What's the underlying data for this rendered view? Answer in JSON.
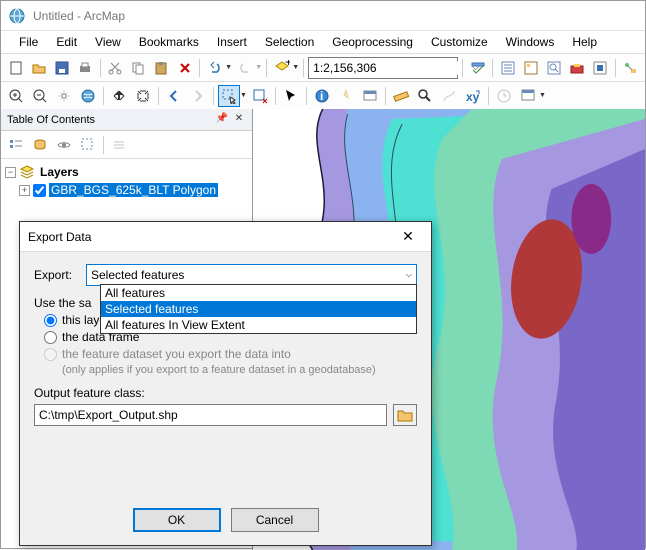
{
  "titlebar": {
    "text": "Untitled - ArcMap"
  },
  "menu": {
    "items": [
      "File",
      "Edit",
      "View",
      "Bookmarks",
      "Insert",
      "Selection",
      "Geoprocessing",
      "Customize",
      "Windows",
      "Help"
    ]
  },
  "scale": {
    "value": "1:2,156,306"
  },
  "toc": {
    "title": "Table Of Contents",
    "root": "Layers",
    "layer": "GBR_BGS_625k_BLT Polygon"
  },
  "dialog": {
    "title": "Export Data",
    "export_label": "Export:",
    "export_value": "Selected features",
    "options": [
      "All features",
      "Selected features",
      "All features In View Extent"
    ],
    "use_same_text": "Use the sa",
    "radio_source": "this layer's source data",
    "radio_frame": "the data frame",
    "radio_dataset": "the feature dataset you export the data into",
    "dataset_hint": "(only applies if you export to a feature dataset in a geodatabase)",
    "output_label": "Output feature class:",
    "output_value": "C:\\tmp\\Export_Output.shp",
    "ok": "OK",
    "cancel": "Cancel"
  }
}
